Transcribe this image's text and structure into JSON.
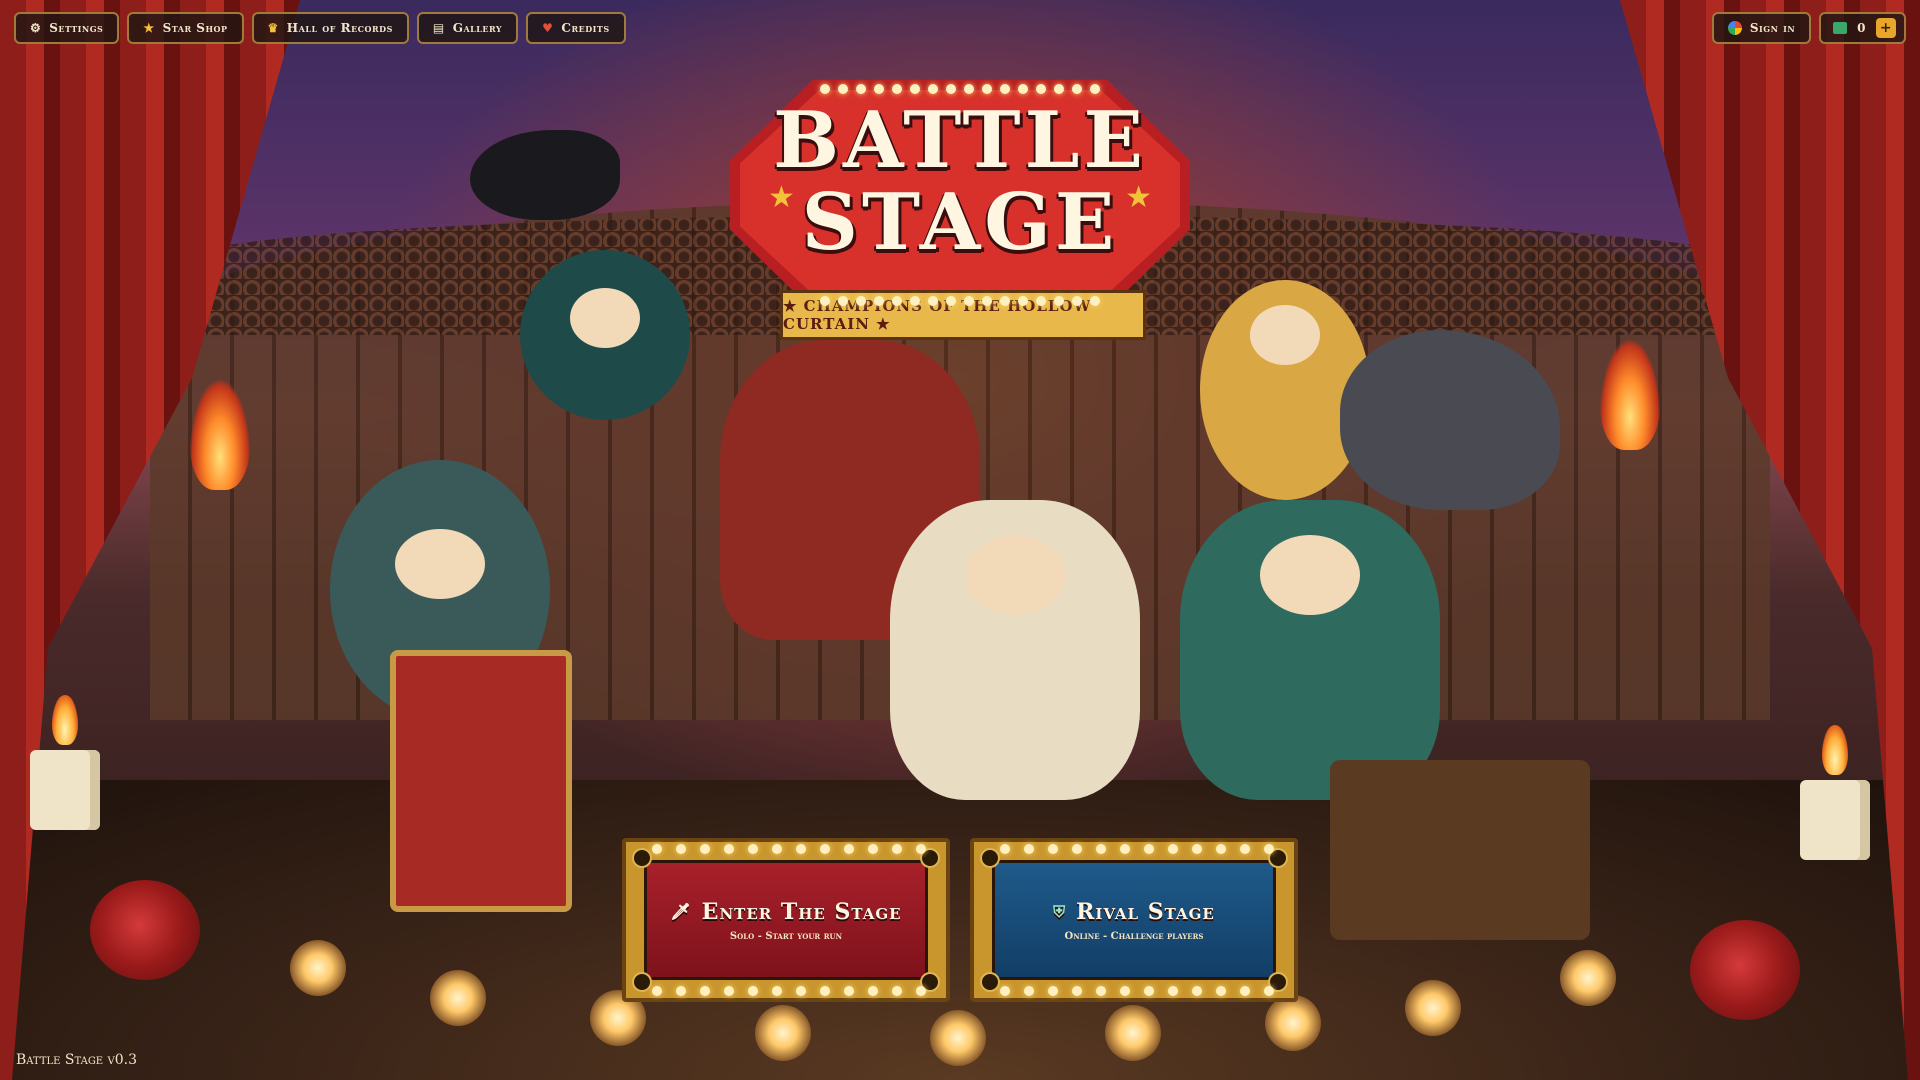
{
  "topnav": {
    "items": [
      {
        "label": "Settings",
        "icon": "gear-icon",
        "glyph": "⚙"
      },
      {
        "label": "Star Shop",
        "icon": "star-icon",
        "glyph": "★"
      },
      {
        "label": "Hall of Records",
        "icon": "crown-icon",
        "glyph": "♛"
      },
      {
        "label": "Gallery",
        "icon": "book-icon",
        "glyph": "▤"
      },
      {
        "label": "Credits",
        "icon": "heart-icon",
        "glyph": "♥"
      }
    ]
  },
  "account": {
    "signin_label": "Sign in",
    "currency_amount": "0",
    "add_label": "+"
  },
  "logo": {
    "title_line1": "BATTLE",
    "title_line2": "STAGE",
    "tagline": "★ CHAMPIONS OF THE HOLLOW CURTAIN ★"
  },
  "modes": {
    "solo": {
      "icon": "sword-icon",
      "glyph": "🗡",
      "title": "Enter The Stage",
      "subtitle": "Solo - Start your run"
    },
    "rival": {
      "icon": "shield-icon",
      "glyph": "⛨",
      "title": "Rival Stage",
      "subtitle": "Online - Challenge players"
    }
  },
  "footer": {
    "version": "Battle Stage v0.3"
  },
  "colors": {
    "accent_gold": "#c9962e",
    "solo_red": "#a8202a",
    "rival_blue": "#1e5a8a",
    "curtain_red": "#b02a22"
  }
}
